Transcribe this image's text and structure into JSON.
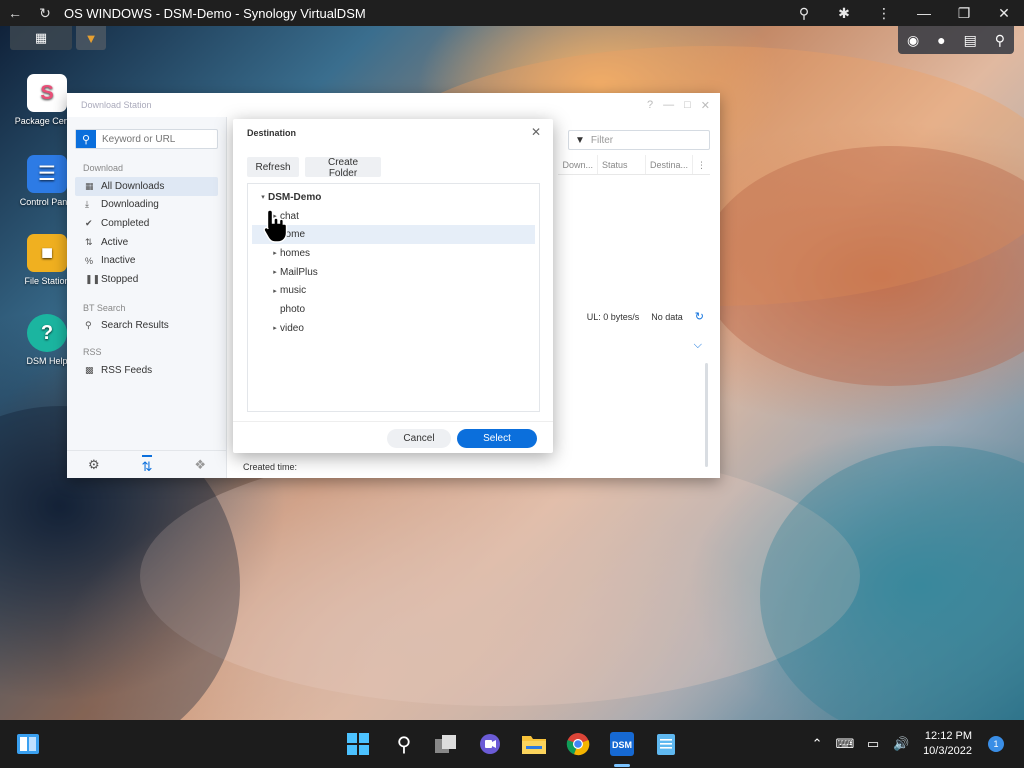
{
  "browser": {
    "title": "OS WINDOWS - DSM-Demo - Synology VirtualDSM"
  },
  "desktop_icons": [
    "Package Center",
    "Control Panel",
    "File Station",
    "DSM Help"
  ],
  "download_station": {
    "title": "Download Station",
    "search_placeholder": "Keyword or URL",
    "section_download": "Download",
    "nav": [
      "All Downloads",
      "Downloading",
      "Completed",
      "Active",
      "Inactive",
      "Stopped"
    ],
    "section_bt": "BT Search",
    "bt_item": "Search Results",
    "section_rss": "RSS",
    "rss_item": "RSS Feeds",
    "filter_placeholder": "Filter",
    "columns": [
      "Down...",
      "Status",
      "Destina..."
    ],
    "status_ul": "UL: 0 bytes/s",
    "status_nodata": "No data",
    "created_time_label": "Created time:"
  },
  "dialog": {
    "title": "Destination",
    "refresh_label": "Refresh",
    "create_folder_label": "Create Folder",
    "root": "DSM-Demo",
    "folders": [
      "chat",
      "home",
      "homes",
      "MailPlus",
      "music",
      "photo",
      "video"
    ],
    "cancel_label": "Cancel",
    "select_label": "Select"
  },
  "clock": {
    "time": "12:12 PM",
    "date": "10/3/2022"
  },
  "notification_count": "1"
}
